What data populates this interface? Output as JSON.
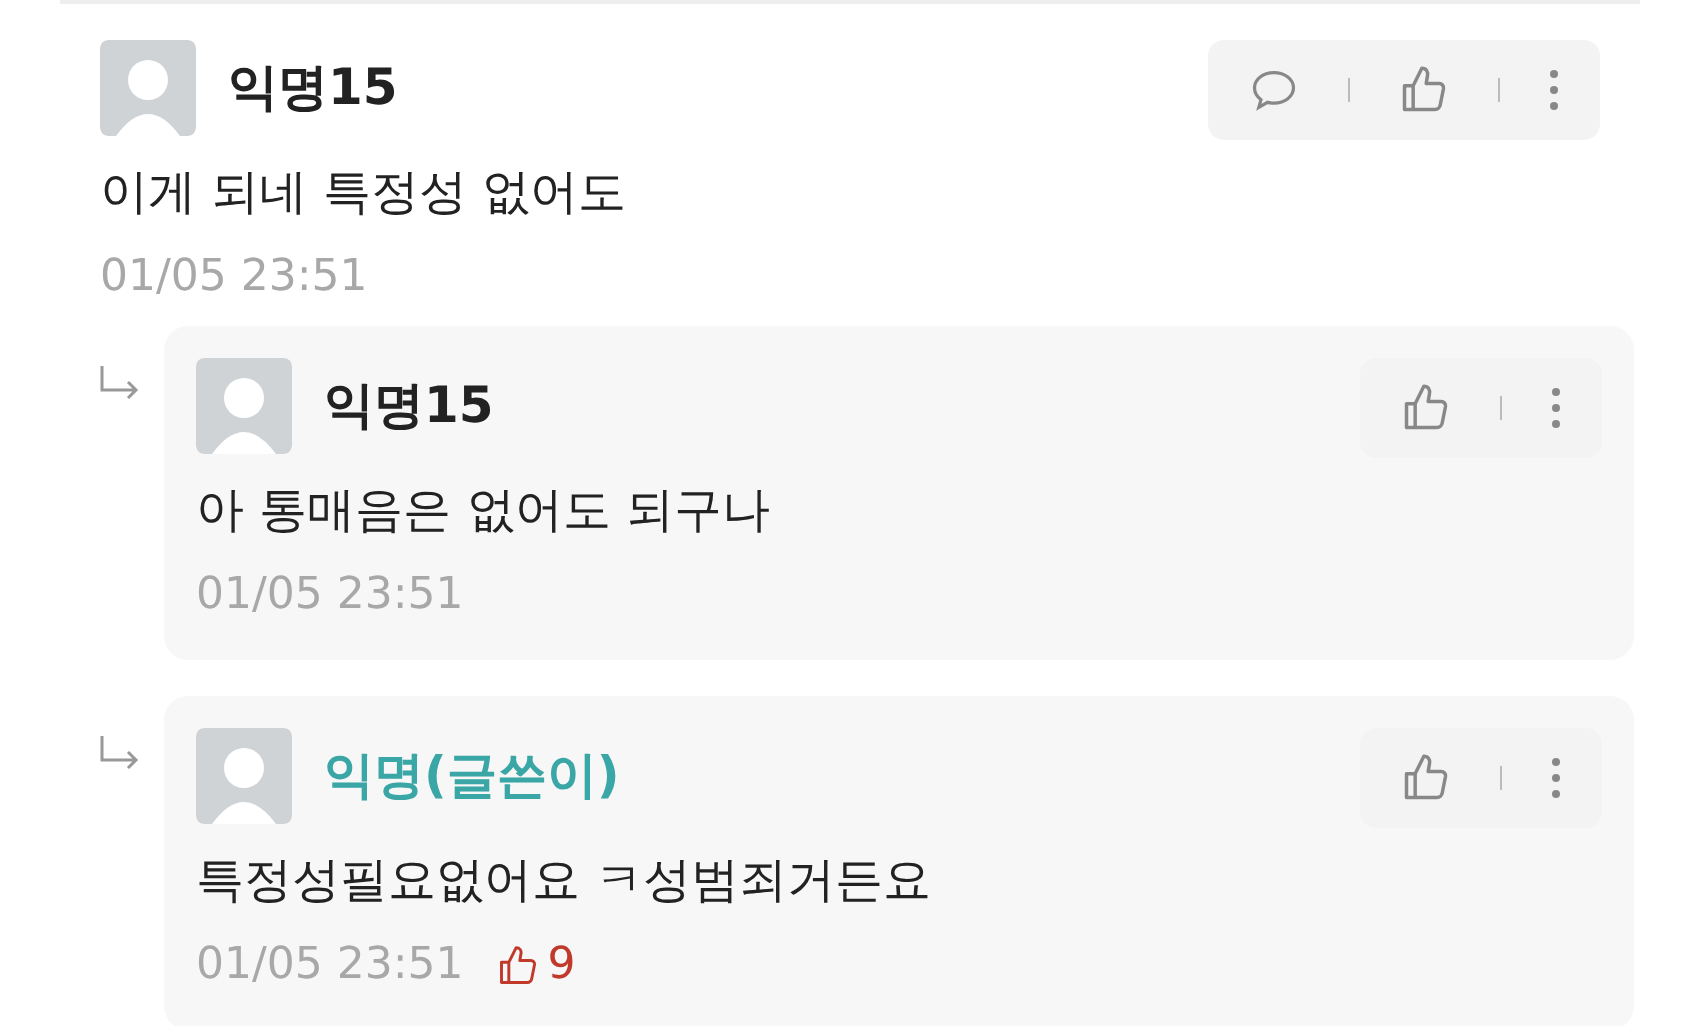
{
  "comments": [
    {
      "author": "익명15",
      "is_writer": false,
      "text": "이게 되네 특정성 없어도",
      "time": "01/05 23:51",
      "reply_button": true,
      "replies": [
        {
          "author": "익명15",
          "is_writer": false,
          "text": "아 통매음은 없어도 되구나",
          "time": "01/05 23:51",
          "reply_button": false
        },
        {
          "author": "익명(글쓴이)",
          "is_writer": true,
          "text": "특정성필요없어요 ㅋ성범죄거든요",
          "time": "01/05 23:51",
          "likes": "9",
          "reply_button": false
        }
      ]
    }
  ]
}
